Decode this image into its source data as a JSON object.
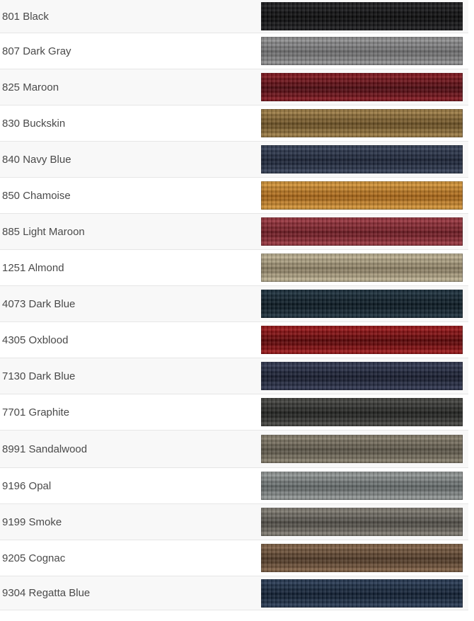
{
  "colors": [
    {
      "label": "801 Black",
      "swatch": [
        "#0b0b0c",
        "#1f1f22"
      ]
    },
    {
      "label": "807 Dark Gray",
      "swatch": [
        "#6d6d6e",
        "#9a9a9b"
      ]
    },
    {
      "label": "825 Maroon",
      "swatch": [
        "#4d0a10",
        "#8c1a22"
      ]
    },
    {
      "label": "830 Buckskin",
      "swatch": [
        "#6a4f23",
        "#a8864c"
      ]
    },
    {
      "label": "840 Navy Blue",
      "swatch": [
        "#1a2235",
        "#38445c"
      ]
    },
    {
      "label": "850 Chamoise",
      "swatch": [
        "#a66416",
        "#e0a040"
      ]
    },
    {
      "label": "885 Light Maroon",
      "swatch": [
        "#6d1a22",
        "#a23a44"
      ]
    },
    {
      "label": "1251 Almond",
      "swatch": [
        "#8a7d62",
        "#c9bd9d"
      ]
    },
    {
      "label": "4073 Dark Blue",
      "swatch": [
        "#0a1821",
        "#1f3442"
      ]
    },
    {
      "label": "4305 Oxblood",
      "swatch": [
        "#5a0406",
        "#a81a1c"
      ]
    },
    {
      "label": "7130 Dark Blue",
      "swatch": [
        "#161b2d",
        "#343b56"
      ]
    },
    {
      "label": "7701 Graphite",
      "swatch": [
        "#20211f",
        "#4a4a46"
      ]
    },
    {
      "label": "8991 Sandalwood",
      "swatch": [
        "#5a5447",
        "#908774"
      ]
    },
    {
      "label": "9196 Opal",
      "swatch": [
        "#616767",
        "#9ea3a2"
      ]
    },
    {
      "label": "9199 Smoke",
      "swatch": [
        "#4e4b45",
        "#8a857b"
      ]
    },
    {
      "label": "9205 Cognac",
      "swatch": [
        "#4e3826",
        "#8b6a4d"
      ]
    },
    {
      "label": "9304 Regatta Blue",
      "swatch": [
        "#0f1d30",
        "#2c3f5a"
      ]
    }
  ]
}
